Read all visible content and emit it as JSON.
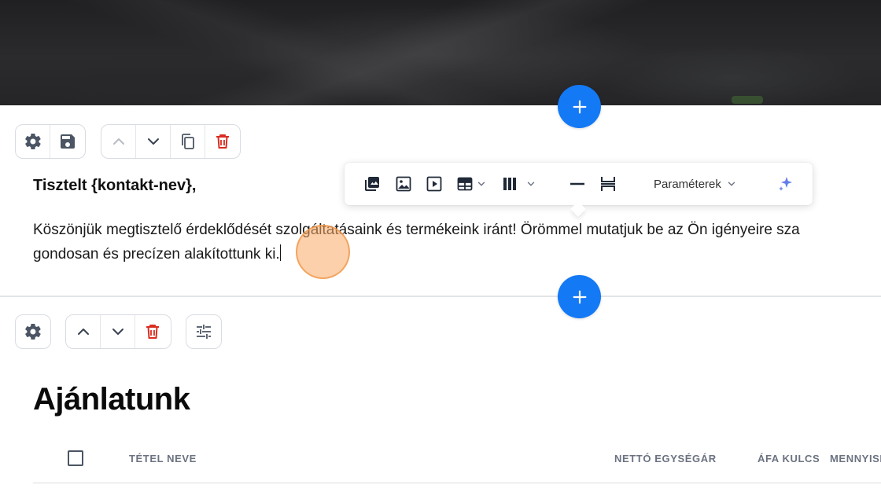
{
  "text_block": {
    "greeting": "Tisztelt {kontakt-nev},",
    "paragraph_line1": "Köszönjük megtisztelő érdeklődését szolgáltatásaink és termékeink iránt! Örömmel mutatjuk be az Ön igényeire sza",
    "paragraph_line2": "gondosan és precízen alakítottunk ki."
  },
  "toolbar": {
    "params_label": "Paraméterek",
    "icons": [
      "gallery-icon",
      "image-icon",
      "video-icon",
      "table-icon",
      "columns-icon",
      "horizontal-rule-icon",
      "spacer-icon",
      "ai-sparkle-icon"
    ]
  },
  "offer_section": {
    "title": "Ajánlatunk",
    "table_headers": {
      "item_name": "TÉTEL NEVE",
      "net_unit_price": "NETTÓ EGYSÉGÁR",
      "vat_rate": "ÁFA KULCS",
      "quantity": "MENNYISÉ"
    }
  },
  "colors": {
    "accent_blue": "#1479f5",
    "delete_red": "#d92d20",
    "icon_gray": "#4b5563"
  }
}
